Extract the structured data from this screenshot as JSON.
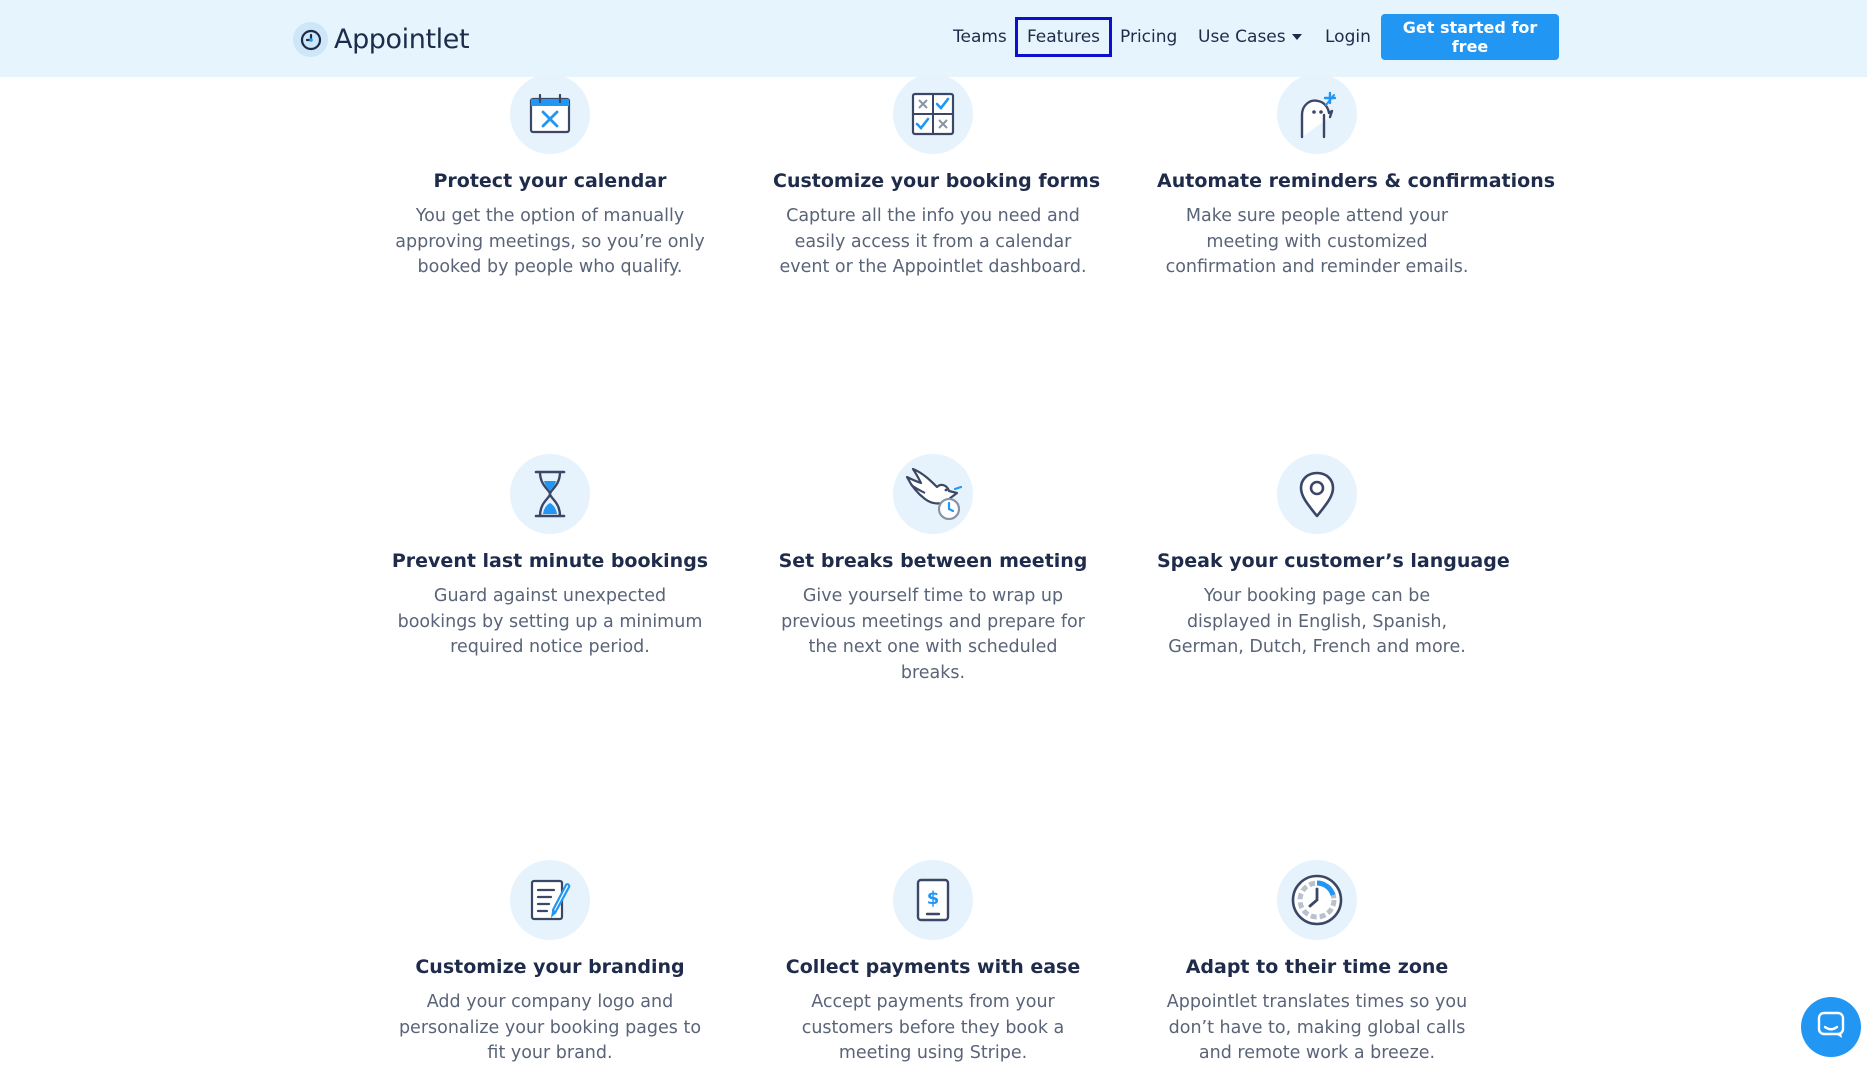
{
  "nav": {
    "logo_text": "Appointlet",
    "links": {
      "teams": "Teams",
      "features": "Features",
      "pricing": "Pricing",
      "use_cases": "Use Cases",
      "login": "Login"
    },
    "cta_label": "Get started for free"
  },
  "features": [
    {
      "title": "Protect your calendar",
      "description": "You get the option of manually approving meetings, so you’re only booked by people who qualify.",
      "icon": "calendar-x-icon"
    },
    {
      "title": "Customize your booking forms",
      "description": "Capture all the info you need and easily access it from a calendar event or the Appointlet dashboard.",
      "icon": "checkbox-grid-icon"
    },
    {
      "title": "Automate reminders & confirmations",
      "description": "Make sure people attend your meeting with customized confirmation and reminder emails.",
      "icon": "bird-reminder-icon"
    },
    {
      "title": "Prevent last minute bookings",
      "description": "Guard against unexpected bookings by setting up a minimum required notice period.",
      "icon": "hourglass-icon"
    },
    {
      "title": "Set breaks between meeting",
      "description": "Give yourself time to wrap up previous meetings and prepare for the next one with scheduled breaks.",
      "icon": "dove-clock-icon"
    },
    {
      "title": "Speak your customer’s language",
      "description": "Your booking page can be displayed in English, Spanish, German, Dutch, French and more.",
      "icon": "location-pin-icon"
    },
    {
      "title": "Customize your branding",
      "description": "Add your company logo and personalize your booking pages to fit your brand.",
      "icon": "document-pen-icon"
    },
    {
      "title": "Collect payments with ease",
      "description": "Accept payments from your customers before they book a meeting using Stripe.",
      "icon": "dollar-document-icon"
    },
    {
      "title": "Adapt to their time zone",
      "description": "Appointlet translates times so you don’t have to, making global calls and remote work a breeze.",
      "icon": "clock-icon"
    }
  ],
  "colors": {
    "nav_background": "#e6f4fd",
    "accent": "#2196f3",
    "heading": "#1e2b4a",
    "body_text": "#5a6478",
    "focus_outline": "#0a0fd0"
  },
  "chat": {
    "icon": "chat-icon"
  }
}
